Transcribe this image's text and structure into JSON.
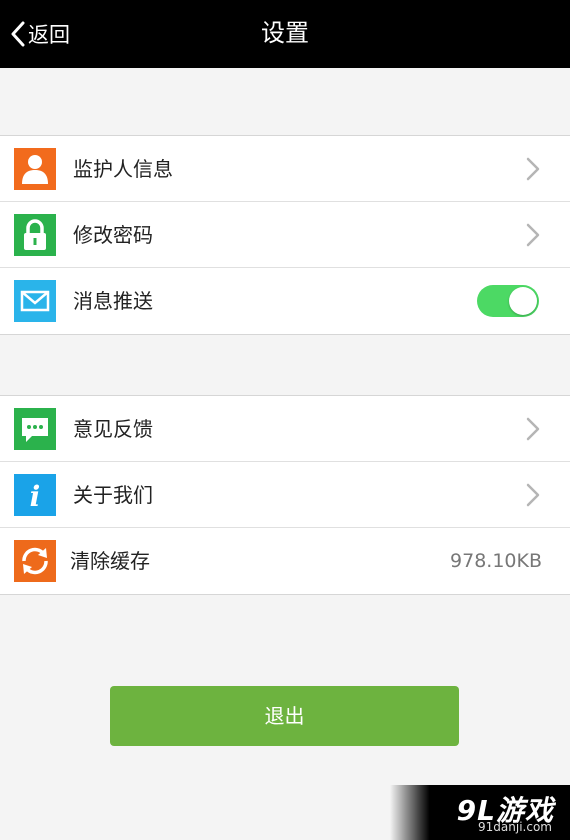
{
  "header": {
    "back_label": "返回",
    "title": "设置"
  },
  "group1": [
    {
      "label": "监护人信息",
      "icon": "person-icon",
      "icon_color": "#f26b1d",
      "trailing": "chevron"
    },
    {
      "label": "修改密码",
      "icon": "lock-icon",
      "icon_color": "#2bb24c",
      "trailing": "chevron"
    },
    {
      "label": "消息推送",
      "icon": "mail-icon",
      "icon_color": "#2ab4ea",
      "trailing": "toggle",
      "toggle_on": true
    }
  ],
  "group2": [
    {
      "label": "意见反馈",
      "icon": "chat-bubble-icon",
      "icon_color": "#2bb24c",
      "trailing": "chevron"
    },
    {
      "label": "关于我们",
      "icon": "info-icon",
      "icon_color": "#1aa3e8",
      "trailing": "chevron"
    },
    {
      "label": "清除缓存",
      "icon": "refresh-icon",
      "icon_color": "#ee6a1b",
      "trailing": "value",
      "value": "978.10KB"
    }
  ],
  "logout_label": "退出",
  "watermark": {
    "logo": "9L游戏",
    "site": "91danji.com"
  },
  "colors": {
    "topbar": "#000000",
    "toggle_on": "#4cd964",
    "logout_button": "#6db33f"
  }
}
